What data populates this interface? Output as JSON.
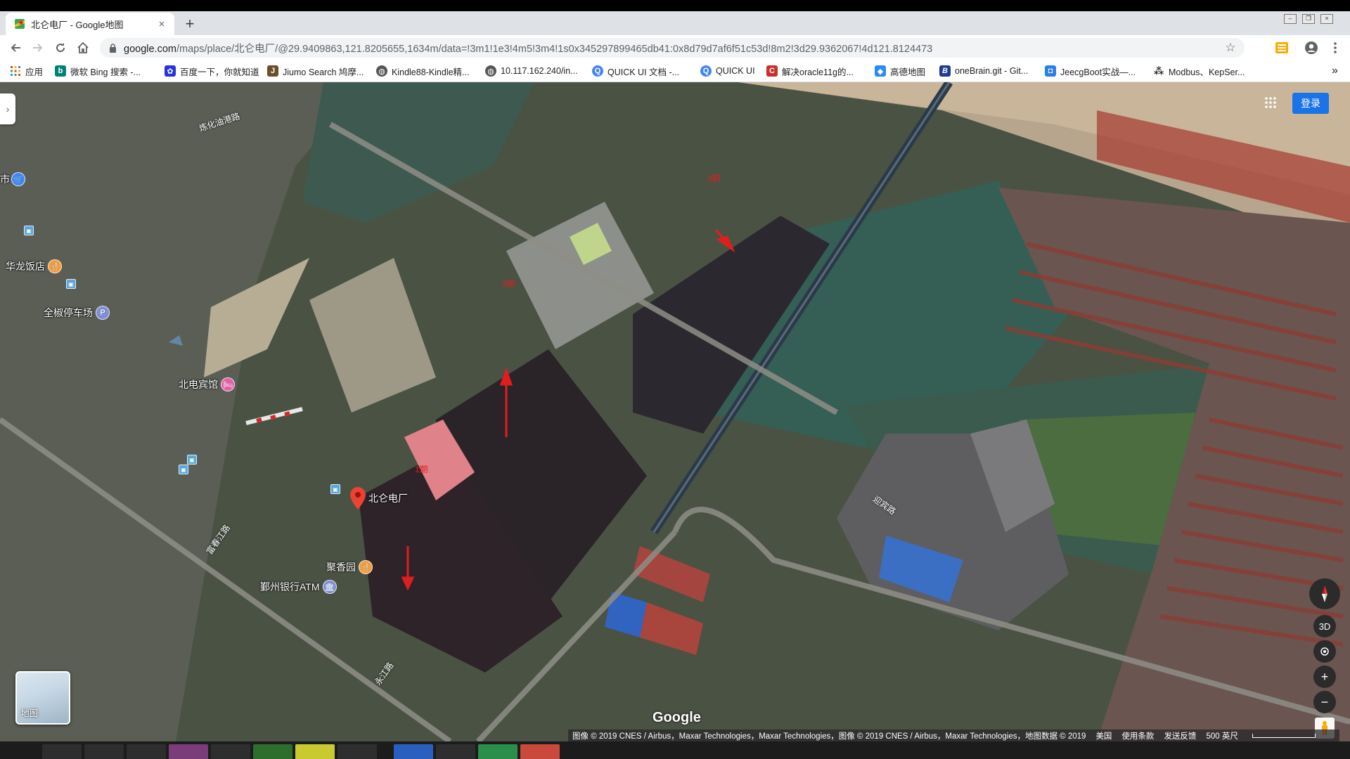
{
  "browser": {
    "tab_title": "北仑电厂 - Google地图",
    "tab_close": "×",
    "new_tab": "+",
    "url_host": "google.com",
    "url_rest": "/maps/place/北仑电厂/@29.9409863,121.8205655,1634m/data=!3m1!1e3!4m5!3m4!1s0x345297899465db41:0x8d79d7af6f51c53d!8m2!3d29.9362067!4d121.8124473"
  },
  "bookmarks": [
    {
      "label": "应用",
      "icon": "apps-grid-icon",
      "color": "#e8453c"
    },
    {
      "label": "微软 Bing 搜索 -...",
      "icon": "bing-icon",
      "color": "#008373"
    },
    {
      "label": "百度一下，你就知道",
      "icon": "baidu-icon",
      "color": "#2932e1"
    },
    {
      "label": "Jiumo Search 鸠摩...",
      "icon": "jiumo-icon",
      "color": "#6b4f2a"
    },
    {
      "label": "Kindle88-Kindle精...",
      "icon": "globe-icon",
      "color": "#555555"
    },
    {
      "label": "10.117.162.240/in...",
      "icon": "globe-icon",
      "color": "#555555"
    },
    {
      "label": "QUICK UI 文档 -...",
      "icon": "quickui-icon",
      "color": "#4285f4"
    },
    {
      "label": "QUICK UI",
      "icon": "quickui-icon",
      "color": "#4285f4"
    },
    {
      "label": "解决oracle11g的...",
      "icon": "csdn-icon",
      "color": "#c9302c"
    },
    {
      "label": "高德地图",
      "icon": "amap-icon",
      "color": "#2a8bf2"
    },
    {
      "label": "oneBrain.git - Git...",
      "icon": "onebrain-icon",
      "color": "#1f3a93"
    },
    {
      "label": "JeecgBoot实战—...",
      "icon": "jeecg-icon",
      "color": "#2b7de9"
    },
    {
      "label": "Modbus、KepSer...",
      "icon": "modbus-icon",
      "color": "#333333"
    }
  ],
  "map": {
    "signin": "登录",
    "layer_label": "地图",
    "view_3d": "3D",
    "zoom_in": "+",
    "zoom_out": "−",
    "google": "Google",
    "pois": {
      "hualong": "华龙饭店",
      "quanjiao": "全椒停车场",
      "beidian": "北电宾馆",
      "beilun": "北仑电厂",
      "juxiang": "聚香园",
      "yinzhou": "鄞州银行ATM",
      "shi": "市"
    },
    "roads": {
      "lianhua": "炼化油港路",
      "fuchun": "富春江路",
      "yingbin": "迎宾路",
      "yongjiang": "永江路"
    },
    "annotations": [
      "3期",
      "2期",
      "1期"
    ],
    "attribution": {
      "imagery": "图像 © 2019 CNES / Airbus，Maxar Technologies，Maxar Technologies，图像 © 2019 CNES / Airbus，Maxar Technologies，地图数据 © 2019",
      "china": "美国",
      "terms": "使用条款",
      "feedback": "发送反馈",
      "scale": "500 英尺"
    }
  }
}
